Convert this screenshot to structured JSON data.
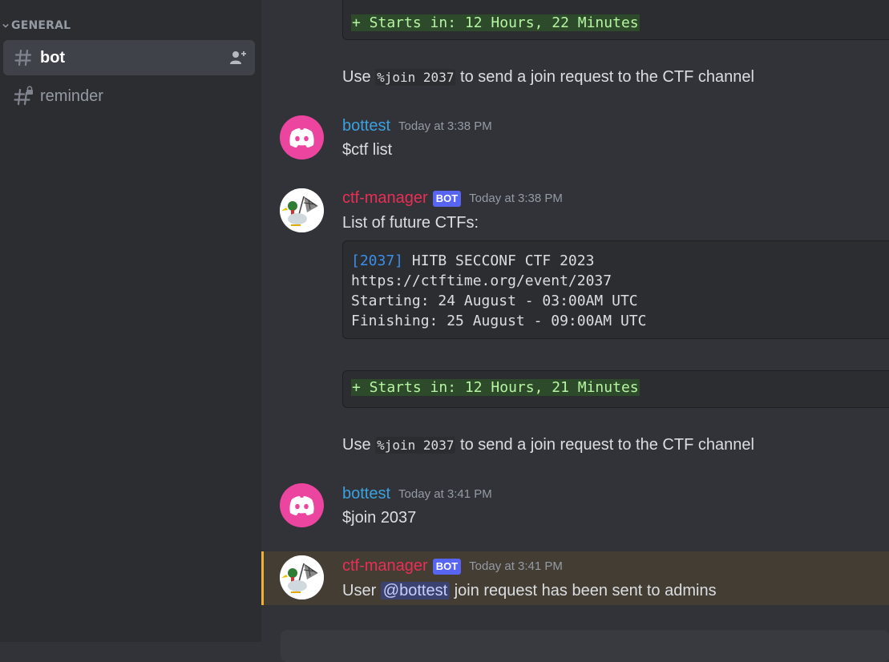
{
  "sidebar": {
    "category": "GENERAL",
    "channels": [
      {
        "name": "bot",
        "active": true
      },
      {
        "name": "reminder",
        "active": false
      }
    ]
  },
  "messages": {
    "diff1": "+ Starts in: 12 Hours, 22 Minutes",
    "join_hint1": {
      "pre": "Use ",
      "code": "%join 2037",
      "post": " to send a join request to the CTF channel"
    },
    "m1": {
      "author": "bottest",
      "timestamp": "Today at 3:38 PM",
      "text": "$ctf list"
    },
    "m2": {
      "author": "ctf-manager",
      "badge": "BOT",
      "timestamp": "Today at 3:38 PM",
      "text": "List of future CTFs:",
      "code": {
        "id": "[2037]",
        "title": " HITB SECCONF CTF 2023",
        "url": "https://ctftime.org/event/2037",
        "starting": "Starting: 24 August - 03:00AM UTC",
        "finishing": "Finishing: 25 August - 09:00AM UTC"
      },
      "diff": "+ Starts in: 12 Hours, 21 Minutes",
      "join_hint": {
        "pre": "Use ",
        "code": "%join 2037",
        "post": " to send a join request to the CTF channel"
      }
    },
    "m3": {
      "author": "bottest",
      "timestamp": "Today at 3:41 PM",
      "text": "$join 2037"
    },
    "m4": {
      "author": "ctf-manager",
      "badge": "BOT",
      "timestamp": "Today at 3:41 PM",
      "pre": "User ",
      "mention": "@bottest",
      "post": " join request has been sent to admins"
    }
  },
  "colors": {
    "user_bottest": "#3ba1df",
    "user_ctf_manager": "#e92f55",
    "accent": "#5865f2",
    "discord_pink": "#eb459f"
  }
}
